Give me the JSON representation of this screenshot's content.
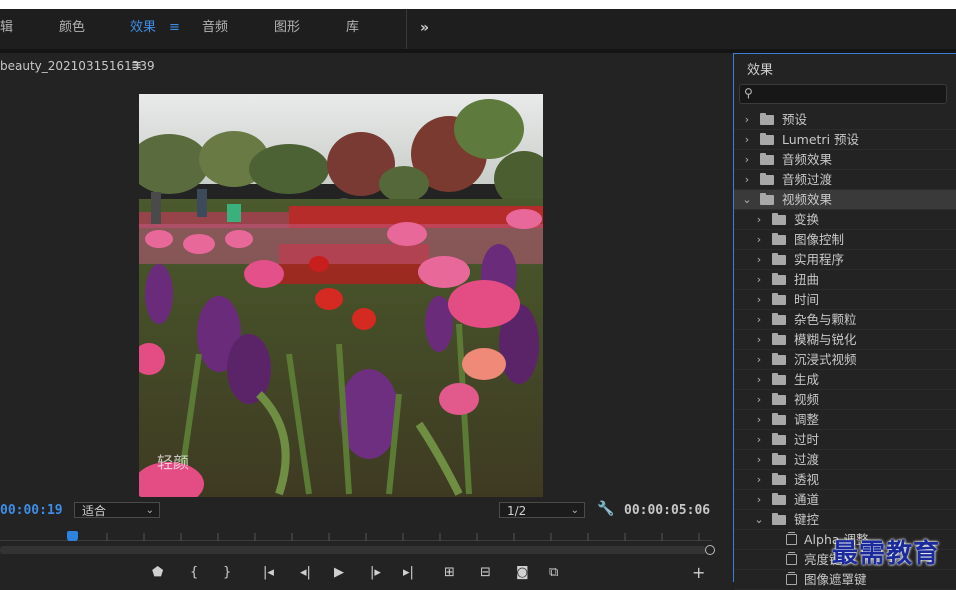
{
  "topbar": {
    "tabs": [
      {
        "label": "辑",
        "active": false
      },
      {
        "label": "颜色",
        "active": false
      },
      {
        "label": "效果",
        "active": true
      },
      {
        "label": "音频",
        "active": false
      },
      {
        "label": "图形",
        "active": false
      },
      {
        "label": "库",
        "active": false
      }
    ],
    "active_menu_icon": "hamburger-icon",
    "overflow_label": "»"
  },
  "monitor": {
    "title": "beauty_20210315161339",
    "menu_icon": "≡",
    "timecode_current": "00:00:19",
    "zoom_select": "适合",
    "resolution_select": "1/2",
    "timecode_duration": "00:00:05:06",
    "watermark_text": "轻颜"
  },
  "effects_panel": {
    "title": "效果",
    "search_placeholder": "",
    "tree": [
      {
        "label": "预设",
        "level": 0,
        "expanded": false,
        "icon": "preset-bin-icon"
      },
      {
        "label": "Lumetri 预设",
        "level": 0,
        "expanded": false,
        "icon": "preset-bin-icon"
      },
      {
        "label": "音频效果",
        "level": 0,
        "expanded": false,
        "icon": "folder-icon"
      },
      {
        "label": "音频过渡",
        "level": 0,
        "expanded": false,
        "icon": "folder-icon"
      },
      {
        "label": "视频效果",
        "level": 0,
        "expanded": true,
        "icon": "folder-icon",
        "highlighted": true
      },
      {
        "label": "变换",
        "level": 1,
        "expanded": false,
        "icon": "folder-icon"
      },
      {
        "label": "图像控制",
        "level": 1,
        "expanded": false,
        "icon": "folder-icon"
      },
      {
        "label": "实用程序",
        "level": 1,
        "expanded": false,
        "icon": "folder-icon"
      },
      {
        "label": "扭曲",
        "level": 1,
        "expanded": false,
        "icon": "folder-icon"
      },
      {
        "label": "时间",
        "level": 1,
        "expanded": false,
        "icon": "folder-icon"
      },
      {
        "label": "杂色与颗粒",
        "level": 1,
        "expanded": false,
        "icon": "folder-icon"
      },
      {
        "label": "模糊与锐化",
        "level": 1,
        "expanded": false,
        "icon": "folder-icon"
      },
      {
        "label": "沉浸式视频",
        "level": 1,
        "expanded": false,
        "icon": "folder-icon"
      },
      {
        "label": "生成",
        "level": 1,
        "expanded": false,
        "icon": "folder-icon"
      },
      {
        "label": "视频",
        "level": 1,
        "expanded": false,
        "icon": "folder-icon"
      },
      {
        "label": "调整",
        "level": 1,
        "expanded": false,
        "icon": "folder-icon"
      },
      {
        "label": "过时",
        "level": 1,
        "expanded": false,
        "icon": "folder-icon"
      },
      {
        "label": "过渡",
        "level": 1,
        "expanded": false,
        "icon": "folder-icon"
      },
      {
        "label": "透视",
        "level": 1,
        "expanded": false,
        "icon": "folder-icon"
      },
      {
        "label": "通道",
        "level": 1,
        "expanded": false,
        "icon": "folder-icon"
      },
      {
        "label": "键控",
        "level": 1,
        "expanded": true,
        "icon": "folder-icon"
      },
      {
        "label": "Alpha 调整",
        "level": 2,
        "icon": "effect-icon"
      },
      {
        "label": "亮度键",
        "level": 2,
        "icon": "effect-icon"
      },
      {
        "label": "图像遮罩键",
        "level": 2,
        "icon": "effect-icon"
      }
    ]
  },
  "overlay_watermark": "最需教育",
  "colors": {
    "accent": "#3d8ee6",
    "timecode": "#3d8ee6",
    "panel_border": "#3e7fd6",
    "watermark": "#1a2a9c"
  }
}
